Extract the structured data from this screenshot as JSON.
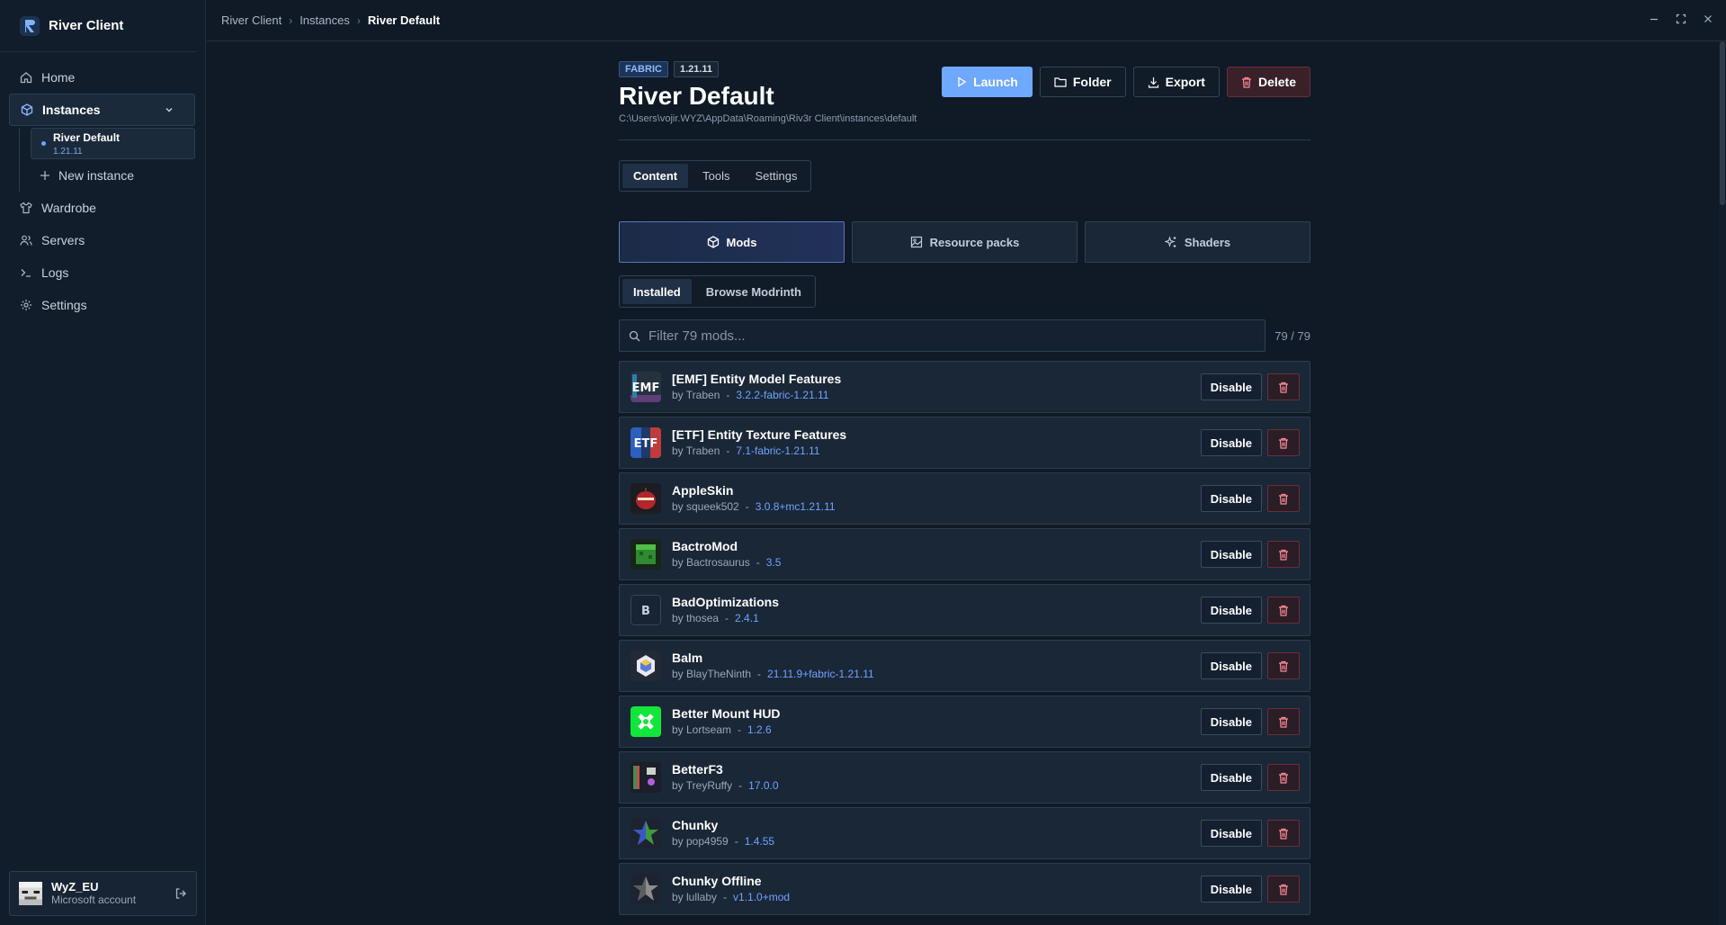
{
  "app": {
    "title": "River Client"
  },
  "sidebar": {
    "home": "Home",
    "instances": "Instances",
    "instance_item": {
      "name": "River Default",
      "version": "1.21.11"
    },
    "new_instance": "New instance",
    "wardrobe": "Wardrobe",
    "servers": "Servers",
    "logs": "Logs",
    "settings": "Settings"
  },
  "account": {
    "name": "WyZ_EU",
    "type": "Microsoft account"
  },
  "breadcrumb": [
    "River Client",
    "Instances",
    "River Default"
  ],
  "instance": {
    "loader": "FABRIC",
    "version": "1.21.11",
    "title": "River Default",
    "path": "C:\\Users\\vojir.WYZ\\AppData\\Roaming\\Riv3r Client\\instances\\default"
  },
  "actions": {
    "launch": "Launch",
    "folder": "Folder",
    "export": "Export",
    "delete": "Delete"
  },
  "tabs": {
    "content": "Content",
    "tools": "Tools",
    "settings": "Settings"
  },
  "content_types": {
    "mods": "Mods",
    "resource_packs": "Resource packs",
    "shaders": "Shaders"
  },
  "subtabs": {
    "installed": "Installed",
    "browse": "Browse Modrinth"
  },
  "filter": {
    "placeholder": "Filter 79 mods...",
    "value": "",
    "count": "79 / 79"
  },
  "mod_labels": {
    "disable": "Disable"
  },
  "mods": [
    {
      "name": "[EMF] Entity Model Features",
      "author": "by Traben",
      "version": "3.2.2-fabric-1.21.11",
      "icon_letters": "EMF"
    },
    {
      "name": "[ETF] Entity Texture Features",
      "author": "by Traben",
      "version": "7.1-fabric-1.21.11",
      "icon_letters": "ETF"
    },
    {
      "name": "AppleSkin",
      "author": "by squeek502",
      "version": "3.0.8+mc1.21.11",
      "icon_letters": ""
    },
    {
      "name": "BactroMod",
      "author": "by Bactrosaurus",
      "version": "3.5",
      "icon_letters": ""
    },
    {
      "name": "BadOptimizations",
      "author": "by thosea",
      "version": "2.4.1",
      "icon_letters": "B"
    },
    {
      "name": "Balm",
      "author": "by BlayTheNinth",
      "version": "21.11.9+fabric-1.21.11",
      "icon_letters": ""
    },
    {
      "name": "Better Mount HUD",
      "author": "by Lortseam",
      "version": "1.2.6",
      "icon_letters": ""
    },
    {
      "name": "BetterF3",
      "author": "by TreyRuffy",
      "version": "17.0.0",
      "icon_letters": ""
    },
    {
      "name": "Chunky",
      "author": "by pop4959",
      "version": "1.4.55",
      "icon_letters": ""
    },
    {
      "name": "Chunky Offline",
      "author": "by lullaby",
      "version": "v1.1.0+mod",
      "icon_letters": ""
    }
  ]
}
